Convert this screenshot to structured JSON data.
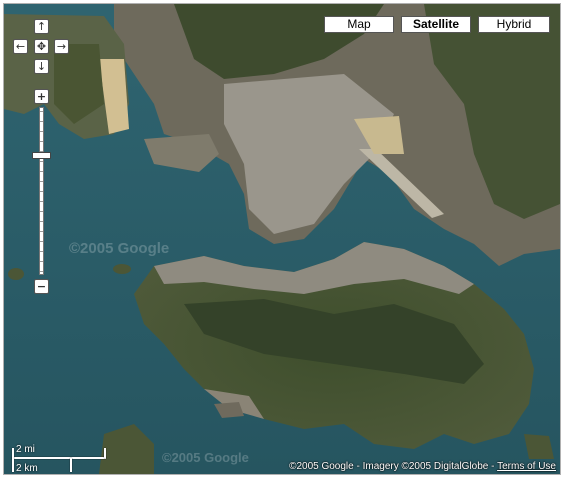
{
  "map": {
    "type_buttons": {
      "map": "Map",
      "satellite": "Satellite",
      "hybrid": "Hybrid",
      "selected": "Satellite"
    },
    "pan": {
      "up": "↑",
      "left": "←",
      "center": "✥",
      "right": "→",
      "down": "↓"
    },
    "zoom": {
      "in": "+",
      "out": "−",
      "level_fraction": 0.28
    },
    "scale": {
      "miles": "2 mi",
      "kilometers": "2 km"
    },
    "copyright": "©2005 Google - Imagery ©2005 DigitalGlobe -",
    "terms_link": "Terms of Use",
    "watermark": "©2005 Google",
    "colors": {
      "water": "#2b5a66",
      "land_dark": "#3b4a2a",
      "urban": "#8e8a80",
      "reclaimed": "#c8b48a"
    }
  }
}
